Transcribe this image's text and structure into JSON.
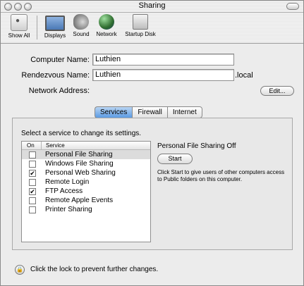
{
  "window": {
    "title": "Sharing"
  },
  "toolbar": {
    "items": [
      {
        "label": "Show All",
        "icon": "show-all-icon"
      },
      {
        "label": "Displays",
        "icon": "displays-icon"
      },
      {
        "label": "Sound",
        "icon": "sound-icon"
      },
      {
        "label": "Network",
        "icon": "network-icon"
      },
      {
        "label": "Startup Disk",
        "icon": "startup-disk-icon"
      }
    ]
  },
  "settings": {
    "computer_name_label": "Computer Name:",
    "computer_name_value": "Luthien",
    "rendezvous_name_label": "Rendezvous Name:",
    "rendezvous_name_value": "Luthien",
    "rendezvous_suffix": ".local",
    "network_address_label": "Network Address:",
    "edit_button": "Edit..."
  },
  "tabs": [
    "Services",
    "Firewall",
    "Internet"
  ],
  "services_panel": {
    "instruction": "Select a service to change its settings.",
    "col_on": "On",
    "col_service": "Service",
    "services": [
      {
        "name": "Personal File Sharing",
        "on": false,
        "selected": true
      },
      {
        "name": "Windows File Sharing",
        "on": false,
        "selected": false
      },
      {
        "name": "Personal Web Sharing",
        "on": true,
        "selected": false
      },
      {
        "name": "Remote Login",
        "on": false,
        "selected": false
      },
      {
        "name": "FTP Access",
        "on": true,
        "selected": false
      },
      {
        "name": "Remote Apple Events",
        "on": false,
        "selected": false
      },
      {
        "name": "Printer Sharing",
        "on": false,
        "selected": false
      }
    ],
    "status": "Personal File Sharing Off",
    "start_button": "Start",
    "description": "Click Start to give users of other computers access to Public folders on this computer."
  },
  "lock": {
    "text": "Click the lock to prevent further changes."
  },
  "colors": {
    "tab_active": "#5c9be3",
    "window_bg": "#ececec"
  }
}
